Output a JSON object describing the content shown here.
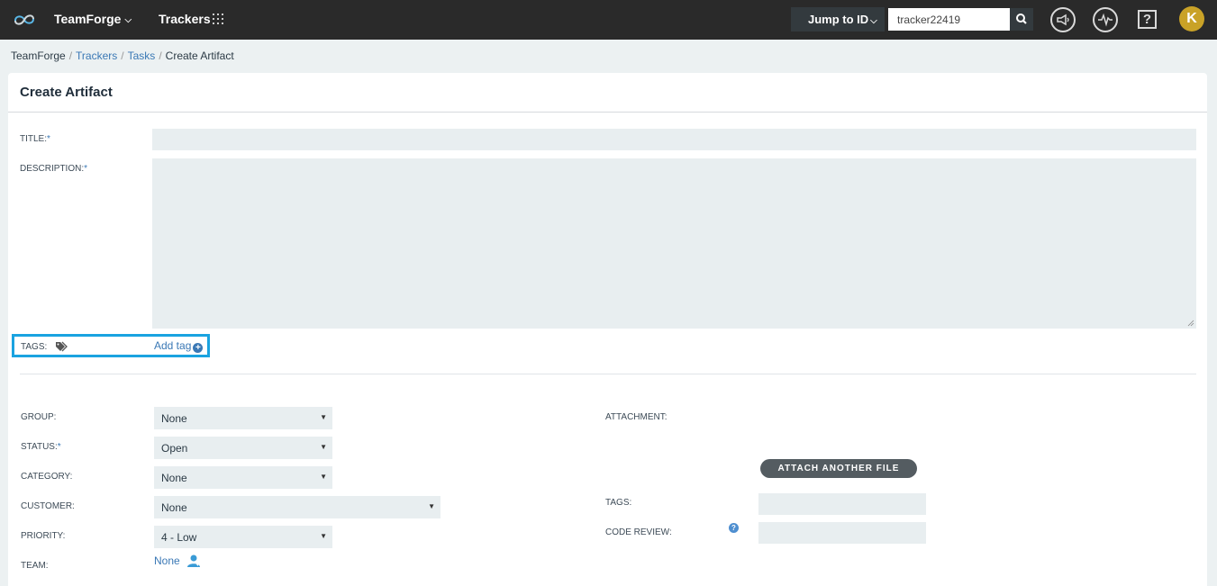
{
  "topbar": {
    "brand": "TeamForge",
    "trackers": "Trackers",
    "jump_label": "Jump to ID",
    "search_value": "tracker22419",
    "avatar_letter": "K",
    "help_glyph": "?"
  },
  "breadcrumb": {
    "root": "TeamForge",
    "trackers": "Trackers",
    "tasks": "Tasks",
    "current": "Create Artifact",
    "sep": "/"
  },
  "page": {
    "title": "Create Artifact"
  },
  "form": {
    "title_label": "TITLE:",
    "description_label": "DESCRIPTION:",
    "required_mark": "*",
    "tags_label": "TAGS:",
    "add_tag": "Add tag",
    "group_label": "GROUP:",
    "group_value": "None",
    "status_label": "STATUS:",
    "status_value": "Open",
    "category_label": "CATEGORY:",
    "category_value": "None",
    "customer_label": "CUSTOMER:",
    "customer_value": "None",
    "priority_label": "PRIORITY:",
    "priority_value": "4 - Low",
    "team_label": "TEAM:",
    "team_value": "None",
    "attachment_label": "ATTACHMENT:",
    "attach_button": "ATTACH ANOTHER FILE",
    "right_tags_label": "TAGS:",
    "code_review_label": "CODE REVIEW:",
    "info_glyph": "?"
  },
  "icons": {
    "logo": "teamforge-logo-icon",
    "apps": "apps-grid-icon",
    "search": "search-icon",
    "announce": "megaphone-icon",
    "activity": "pulse-icon",
    "help": "help-icon",
    "tag": "tag-icon",
    "team": "user-picker-icon"
  },
  "colors": {
    "topbar": "#2a2a2a",
    "accent": "#3a78b5",
    "highlight": "#1aa3e0",
    "field_bg": "#e8eef0",
    "avatar": "#c9a227"
  }
}
